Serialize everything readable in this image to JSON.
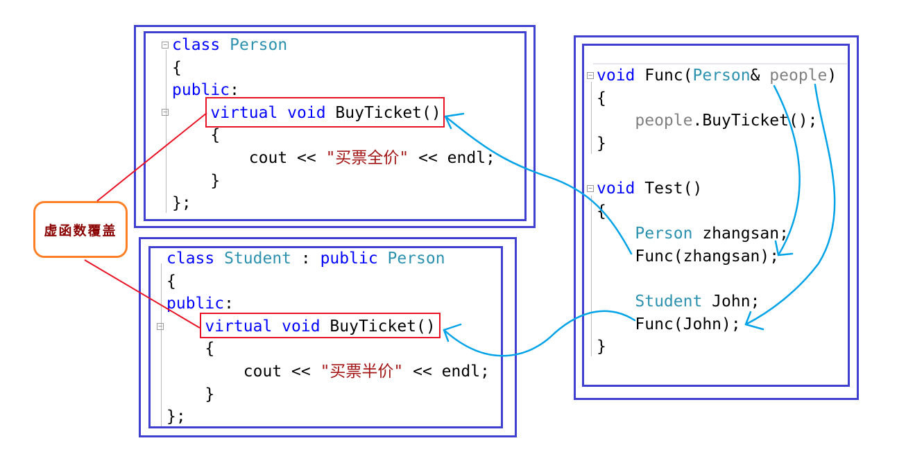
{
  "label": "虚函数覆盖",
  "colors": {
    "frame": "#4040d0",
    "highlight": "#e81123",
    "arrow": "#00a2e8",
    "callout": "#ff7f27"
  },
  "person_class": [
    [
      [
        "kw",
        "class "
      ],
      [
        "ty",
        "Person"
      ]
    ],
    [
      [
        "pl",
        "{"
      ]
    ],
    [
      [
        "kw",
        "public"
      ],
      [
        "pl",
        ":"
      ]
    ],
    [
      [
        "pl",
        "    "
      ],
      [
        "kw",
        "virtual void "
      ],
      [
        "pl",
        "BuyTicket()"
      ]
    ],
    [
      [
        "pl",
        "    {"
      ]
    ],
    [
      [
        "pl",
        "        cout << "
      ],
      [
        "st",
        "\"买票全价\""
      ],
      [
        "pl",
        " << endl;"
      ]
    ],
    [
      [
        "pl",
        "    }"
      ]
    ],
    [
      [
        "pl",
        "};"
      ]
    ]
  ],
  "student_class": [
    [
      [
        "kw",
        "class "
      ],
      [
        "ty",
        "Student"
      ],
      [
        "pl",
        " : "
      ],
      [
        "kw",
        "public "
      ],
      [
        "ty",
        "Person"
      ]
    ],
    [
      [
        "pl",
        "{"
      ]
    ],
    [
      [
        "kw",
        "public"
      ],
      [
        "pl",
        ":"
      ]
    ],
    [
      [
        "pl",
        "    "
      ],
      [
        "kw",
        "virtual void "
      ],
      [
        "pl",
        "BuyTicket()"
      ]
    ],
    [
      [
        "pl",
        "    {"
      ]
    ],
    [
      [
        "pl",
        "        cout << "
      ],
      [
        "st",
        "\"买票半价\""
      ],
      [
        "pl",
        " << endl;"
      ]
    ],
    [
      [
        "pl",
        "    }"
      ]
    ],
    [
      [
        "pl",
        "};"
      ]
    ]
  ],
  "test_code": [
    [
      [
        "kw",
        "void "
      ],
      [
        "pl",
        "Func("
      ],
      [
        "ty",
        "Person"
      ],
      [
        "pl",
        "& "
      ],
      [
        "gr",
        "people"
      ],
      [
        "pl",
        ")"
      ]
    ],
    [
      [
        "pl",
        "{"
      ]
    ],
    [
      [
        "pl",
        "    "
      ],
      [
        "gr",
        "people"
      ],
      [
        "pl",
        ".BuyTicket();"
      ]
    ],
    [
      [
        "pl",
        "}"
      ]
    ],
    [
      [
        "pl",
        ""
      ]
    ],
    [
      [
        "kw",
        "void "
      ],
      [
        "pl",
        "Test()"
      ]
    ],
    [
      [
        "pl",
        "{"
      ]
    ],
    [
      [
        "pl",
        "    "
      ],
      [
        "ty",
        "Person"
      ],
      [
        "pl",
        " zhangsan;"
      ]
    ],
    [
      [
        "pl",
        "    Func(zhangsan);"
      ]
    ],
    [
      [
        "pl",
        ""
      ]
    ],
    [
      [
        "pl",
        "    "
      ],
      [
        "ty",
        "Student"
      ],
      [
        "pl",
        " John;"
      ]
    ],
    [
      [
        "pl",
        "    Func(John);"
      ]
    ],
    [
      [
        "pl",
        "}"
      ]
    ]
  ]
}
